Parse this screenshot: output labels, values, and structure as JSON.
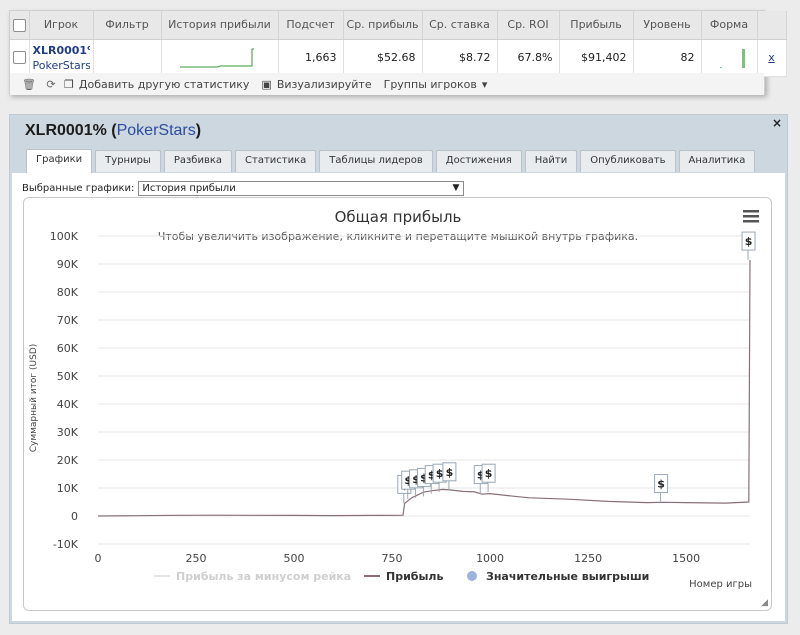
{
  "stats": {
    "headers": [
      "Игрок",
      "Фильтр",
      "История прибыли",
      "Подсчет",
      "Ср. прибыль",
      "Ср. ставка",
      "Ср. ROI",
      "Прибыль",
      "Уровень",
      "Форма",
      ""
    ],
    "row": {
      "player_id": "XLR0001%",
      "player_site": "PokerStars",
      "count": "1,663",
      "avg_profit": "$52.68",
      "avg_stake": "$8.72",
      "avg_roi": "67.8%",
      "profit": "$91,402",
      "level": "82",
      "remove": "x"
    },
    "toolbar": {
      "add_stat": "Добавить другую статистику",
      "visualize": "Визуализируйте",
      "groups": "Группы игроков"
    }
  },
  "dialog": {
    "title_player": "XLR0001%",
    "title_site": "PokerStars",
    "close": "×",
    "tabs": [
      "Графики",
      "Турниры",
      "Разбивка",
      "Статистика",
      "Таблицы лидеров",
      "Достижения",
      "Найти",
      "Опубликовать",
      "Аналитика"
    ],
    "selected_tab": "Графики",
    "select_label": "Выбранные графики:",
    "select_value": "История прибыли"
  },
  "chart_data": {
    "type": "line",
    "title": "Общая прибыль",
    "subtitle": "Чтобы увеличить изображение, кликните и перетащите мышкой внутрь графика.",
    "xlabel": "Номер игры",
    "ylabel": "Суммарный итог (USD)",
    "xlim": [
      0,
      1663
    ],
    "ylim": [
      -10000,
      100000
    ],
    "y_ticks": [
      "100K",
      "90K",
      "80K",
      "70K",
      "60K",
      "50K",
      "40K",
      "30K",
      "20K",
      "10K",
      "0",
      "-10K"
    ],
    "x_ticks": [
      "0",
      "250",
      "500",
      "750",
      "1000",
      "1250",
      "1500"
    ],
    "x_tick_values": [
      0,
      250,
      500,
      750,
      1000,
      1250,
      1500
    ],
    "y_tick_values": [
      100000,
      90000,
      80000,
      70000,
      60000,
      50000,
      40000,
      30000,
      20000,
      10000,
      0,
      -10000
    ],
    "grid": true,
    "legend": [
      {
        "name": "Прибыль за минусом рейка",
        "color": "#e6e6e6"
      },
      {
        "name": "Прибыль",
        "color": "#8a6f78"
      },
      {
        "name": "Значительные выигрыши",
        "color": "#9bb3df"
      }
    ],
    "series": [
      {
        "name": "Прибыль",
        "color": "#8a6f78",
        "x": [
          0,
          100,
          200,
          300,
          400,
          500,
          600,
          700,
          760,
          778,
          782,
          800,
          830,
          850,
          880,
          900,
          930,
          960,
          980,
          1000,
          1050,
          1100,
          1200,
          1300,
          1400,
          1440,
          1500,
          1600,
          1660,
          1663
        ],
        "y": [
          0,
          100,
          250,
          300,
          250,
          200,
          150,
          200,
          250,
          300,
          4500,
          6500,
          8500,
          9000,
          9500,
          9300,
          8800,
          8600,
          7800,
          8000,
          7200,
          6500,
          6000,
          5200,
          4800,
          4900,
          4800,
          4600,
          5000,
          91402
        ]
      }
    ],
    "markers": {
      "name": "Значительные выигрыши",
      "label": "$",
      "x": [
        780,
        790,
        810,
        830,
        850,
        870,
        895,
        975,
        995,
        1435,
        1658
      ],
      "y": [
        4500,
        6000,
        6500,
        7000,
        8000,
        8500,
        9000,
        8000,
        8500,
        4800,
        91402
      ]
    }
  }
}
